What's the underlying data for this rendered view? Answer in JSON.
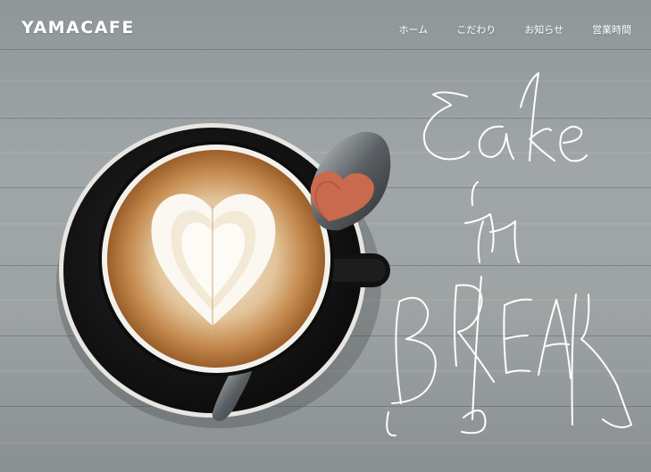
{
  "header": {
    "logo": "YAMACAFE"
  },
  "nav": {
    "items": [
      {
        "label": "ホーム"
      },
      {
        "label": "こだわり"
      },
      {
        "label": "お知らせ"
      },
      {
        "label": "営業時間"
      }
    ]
  },
  "hero": {
    "tagline": "Cake Break"
  },
  "colors": {
    "text": "#ffffff",
    "table": "#9ea3a4",
    "saucer": "#151515",
    "crema": "#c58a4e"
  },
  "icons": [
    "latte-cup",
    "spoon-with-heart-cookie"
  ]
}
